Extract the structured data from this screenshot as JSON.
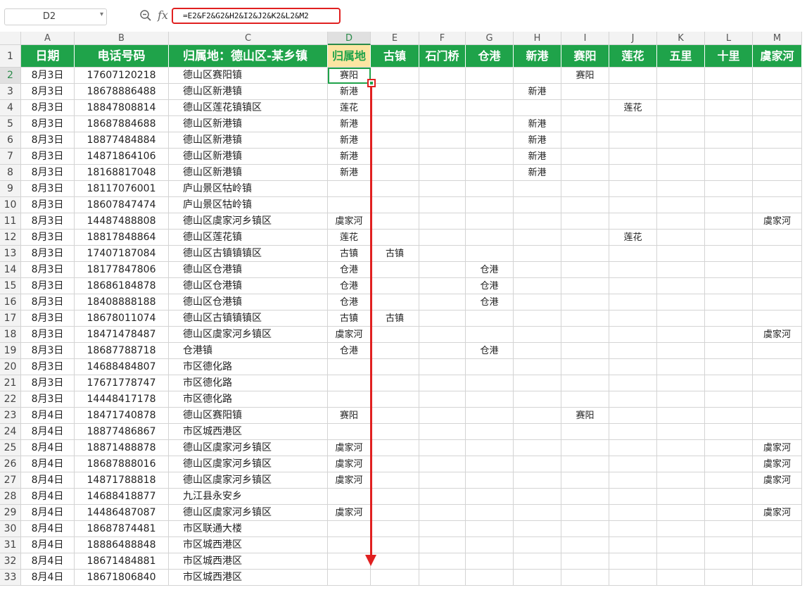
{
  "formula_bar": {
    "name_box": "D2",
    "formula": "=E2&F2&G2&H2&I2&J2&K2&L2&M2"
  },
  "icons": {
    "zoom": "zoom-icon",
    "fx": "fx-icon",
    "name_box_dropdown": "chevron-down-icon"
  },
  "colors": {
    "header_green": "#1fa34a",
    "highlight_yellow": "#fbe5a2",
    "annotation_red": "#e02020"
  },
  "columns": [
    "A",
    "B",
    "C",
    "D",
    "E",
    "F",
    "G",
    "H",
    "I",
    "J",
    "K",
    "L",
    "M"
  ],
  "headers": [
    "日期",
    "电话号码",
    "归属地：德山区-某乡镇",
    "归属地",
    "古镇",
    "石门桥",
    "仓港",
    "新港",
    "赛阳",
    "莲花",
    "五里",
    "十里",
    "虞家河"
  ],
  "rows": [
    [
      "8月3日",
      "17607120218",
      "德山区赛阳镇",
      "赛阳",
      "",
      "",
      "",
      "",
      "赛阳",
      "",
      "",
      "",
      ""
    ],
    [
      "8月3日",
      "18678886488",
      "德山区新港镇",
      "新港",
      "",
      "",
      "",
      "新港",
      "",
      "",
      "",
      "",
      ""
    ],
    [
      "8月3日",
      "18847808814",
      "德山区莲花镇镇区",
      "莲花",
      "",
      "",
      "",
      "",
      "",
      "莲花",
      "",
      "",
      ""
    ],
    [
      "8月3日",
      "18687884688",
      "德山区新港镇",
      "新港",
      "",
      "",
      "",
      "新港",
      "",
      "",
      "",
      "",
      ""
    ],
    [
      "8月3日",
      "18877484884",
      "德山区新港镇",
      "新港",
      "",
      "",
      "",
      "新港",
      "",
      "",
      "",
      "",
      ""
    ],
    [
      "8月3日",
      "14871864106",
      "德山区新港镇",
      "新港",
      "",
      "",
      "",
      "新港",
      "",
      "",
      "",
      "",
      ""
    ],
    [
      "8月3日",
      "18168817048",
      "德山区新港镇",
      "新港",
      "",
      "",
      "",
      "新港",
      "",
      "",
      "",
      "",
      ""
    ],
    [
      "8月3日",
      "18117076001",
      "庐山景区牯岭镇",
      "",
      "",
      "",
      "",
      "",
      "",
      "",
      "",
      "",
      ""
    ],
    [
      "8月3日",
      "18607847474",
      "庐山景区牯岭镇",
      "",
      "",
      "",
      "",
      "",
      "",
      "",
      "",
      "",
      ""
    ],
    [
      "8月3日",
      "14487488808",
      "德山区虞家河乡镇区",
      "虞家河",
      "",
      "",
      "",
      "",
      "",
      "",
      "",
      "",
      "虞家河"
    ],
    [
      "8月3日",
      "18817848864",
      "德山区莲花镇",
      "莲花",
      "",
      "",
      "",
      "",
      "",
      "莲花",
      "",
      "",
      ""
    ],
    [
      "8月3日",
      "17407187084",
      "德山区古镇镇镇区",
      "古镇",
      "古镇",
      "",
      "",
      "",
      "",
      "",
      "",
      "",
      ""
    ],
    [
      "8月3日",
      "18177847806",
      "德山区仓港镇",
      "仓港",
      "",
      "",
      "仓港",
      "",
      "",
      "",
      "",
      "",
      ""
    ],
    [
      "8月3日",
      "18686184878",
      "德山区仓港镇",
      "仓港",
      "",
      "",
      "仓港",
      "",
      "",
      "",
      "",
      "",
      ""
    ],
    [
      "8月3日",
      "18408888188",
      "德山区仓港镇",
      "仓港",
      "",
      "",
      "仓港",
      "",
      "",
      "",
      "",
      "",
      ""
    ],
    [
      "8月3日",
      "18678011074",
      "德山区古镇镇镇区",
      "古镇",
      "古镇",
      "",
      "",
      "",
      "",
      "",
      "",
      "",
      ""
    ],
    [
      "8月3日",
      "18471478487",
      "德山区虞家河乡镇区",
      "虞家河",
      "",
      "",
      "",
      "",
      "",
      "",
      "",
      "",
      "虞家河"
    ],
    [
      "8月3日",
      "18687788718",
      "仓港镇",
      "仓港",
      "",
      "",
      "仓港",
      "",
      "",
      "",
      "",
      "",
      ""
    ],
    [
      "8月3日",
      "14688484807",
      "市区德化路",
      "",
      "",
      "",
      "",
      "",
      "",
      "",
      "",
      "",
      ""
    ],
    [
      "8月3日",
      "17671778747",
      "市区德化路",
      "",
      "",
      "",
      "",
      "",
      "",
      "",
      "",
      "",
      ""
    ],
    [
      "8月3日",
      "14448417178",
      "市区德化路",
      "",
      "",
      "",
      "",
      "",
      "",
      "",
      "",
      "",
      ""
    ],
    [
      "8月4日",
      "18471740878",
      "德山区赛阳镇",
      "赛阳",
      "",
      "",
      "",
      "",
      "赛阳",
      "",
      "",
      "",
      ""
    ],
    [
      "8月4日",
      "18877486867",
      "市区城西港区",
      "",
      "",
      "",
      "",
      "",
      "",
      "",
      "",
      "",
      ""
    ],
    [
      "8月4日",
      "18871488878",
      "德山区虞家河乡镇区",
      "虞家河",
      "",
      "",
      "",
      "",
      "",
      "",
      "",
      "",
      "虞家河"
    ],
    [
      "8月4日",
      "18687888016",
      "德山区虞家河乡镇区",
      "虞家河",
      "",
      "",
      "",
      "",
      "",
      "",
      "",
      "",
      "虞家河"
    ],
    [
      "8月4日",
      "14871788818",
      "德山区虞家河乡镇区",
      "虞家河",
      "",
      "",
      "",
      "",
      "",
      "",
      "",
      "",
      "虞家河"
    ],
    [
      "8月4日",
      "14688418877",
      "九江县永安乡",
      "",
      "",
      "",
      "",
      "",
      "",
      "",
      "",
      "",
      ""
    ],
    [
      "8月4日",
      "14486487087",
      "德山区虞家河乡镇区",
      "虞家河",
      "",
      "",
      "",
      "",
      "",
      "",
      "",
      "",
      "虞家河"
    ],
    [
      "8月4日",
      "18687874481",
      "市区联通大楼",
      "",
      "",
      "",
      "",
      "",
      "",
      "",
      "",
      "",
      ""
    ],
    [
      "8月4日",
      "18886488848",
      "市区城西港区",
      "",
      "",
      "",
      "",
      "",
      "",
      "",
      "",
      "",
      ""
    ],
    [
      "8月4日",
      "18671484881",
      "市区城西港区",
      "",
      "",
      "",
      "",
      "",
      "",
      "",
      "",
      "",
      ""
    ],
    [
      "8月4日",
      "18671806840",
      "市区城西港区",
      "",
      "",
      "",
      "",
      "",
      "",
      "",
      "",
      "",
      ""
    ]
  ]
}
